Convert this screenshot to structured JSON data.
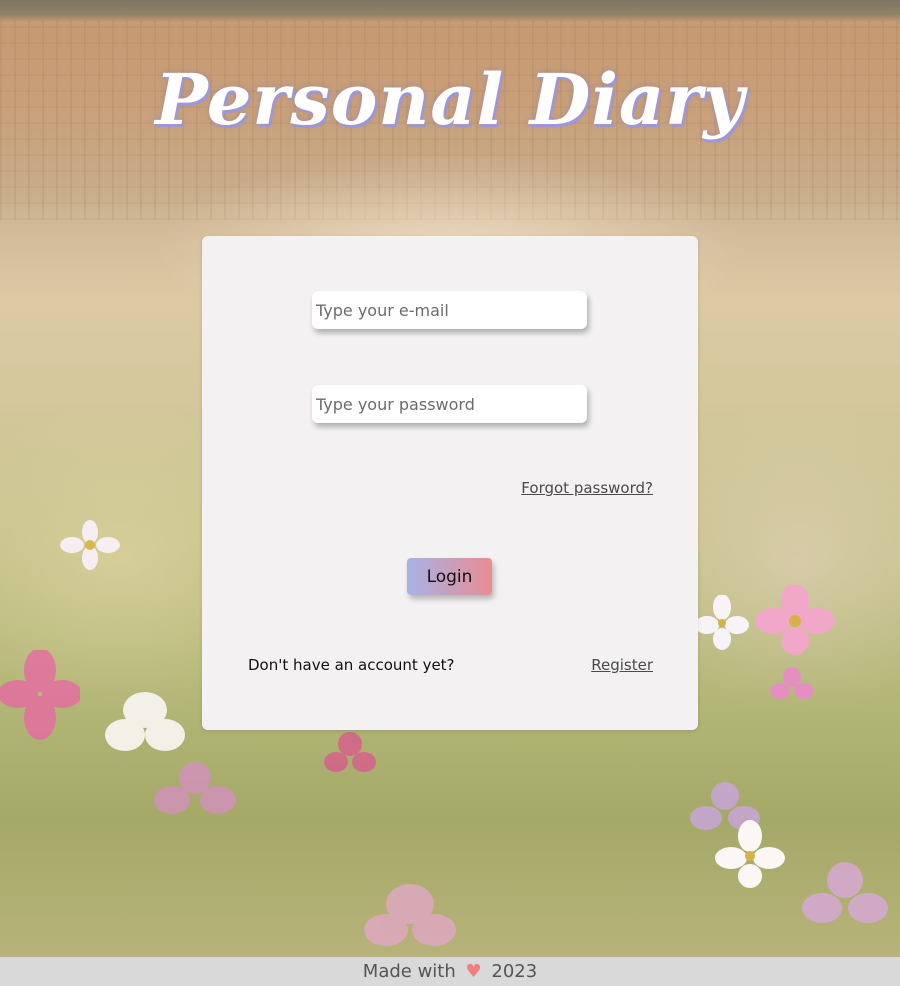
{
  "app": {
    "title": "Personal Diary"
  },
  "login_form": {
    "email_placeholder": "Type your e-mail",
    "password_placeholder": "Type your password",
    "forgot_password_label": "Forgot password?",
    "login_button_label": "Login",
    "no_account_text": "Don't have an account yet?",
    "register_link_label": "Register"
  },
  "footer": {
    "made_with": "Made with",
    "heart_icon": "heart-icon",
    "heart_glyph": "♥",
    "year": "2023"
  },
  "colors": {
    "card_bg": "#f3f1f2",
    "button_gradient_start": "#a6b3e6",
    "button_gradient_end": "#e98c93",
    "title_shadow": "#9e97d6",
    "heart": "#f07f7f",
    "footer_bg": "#d9d9d9"
  }
}
